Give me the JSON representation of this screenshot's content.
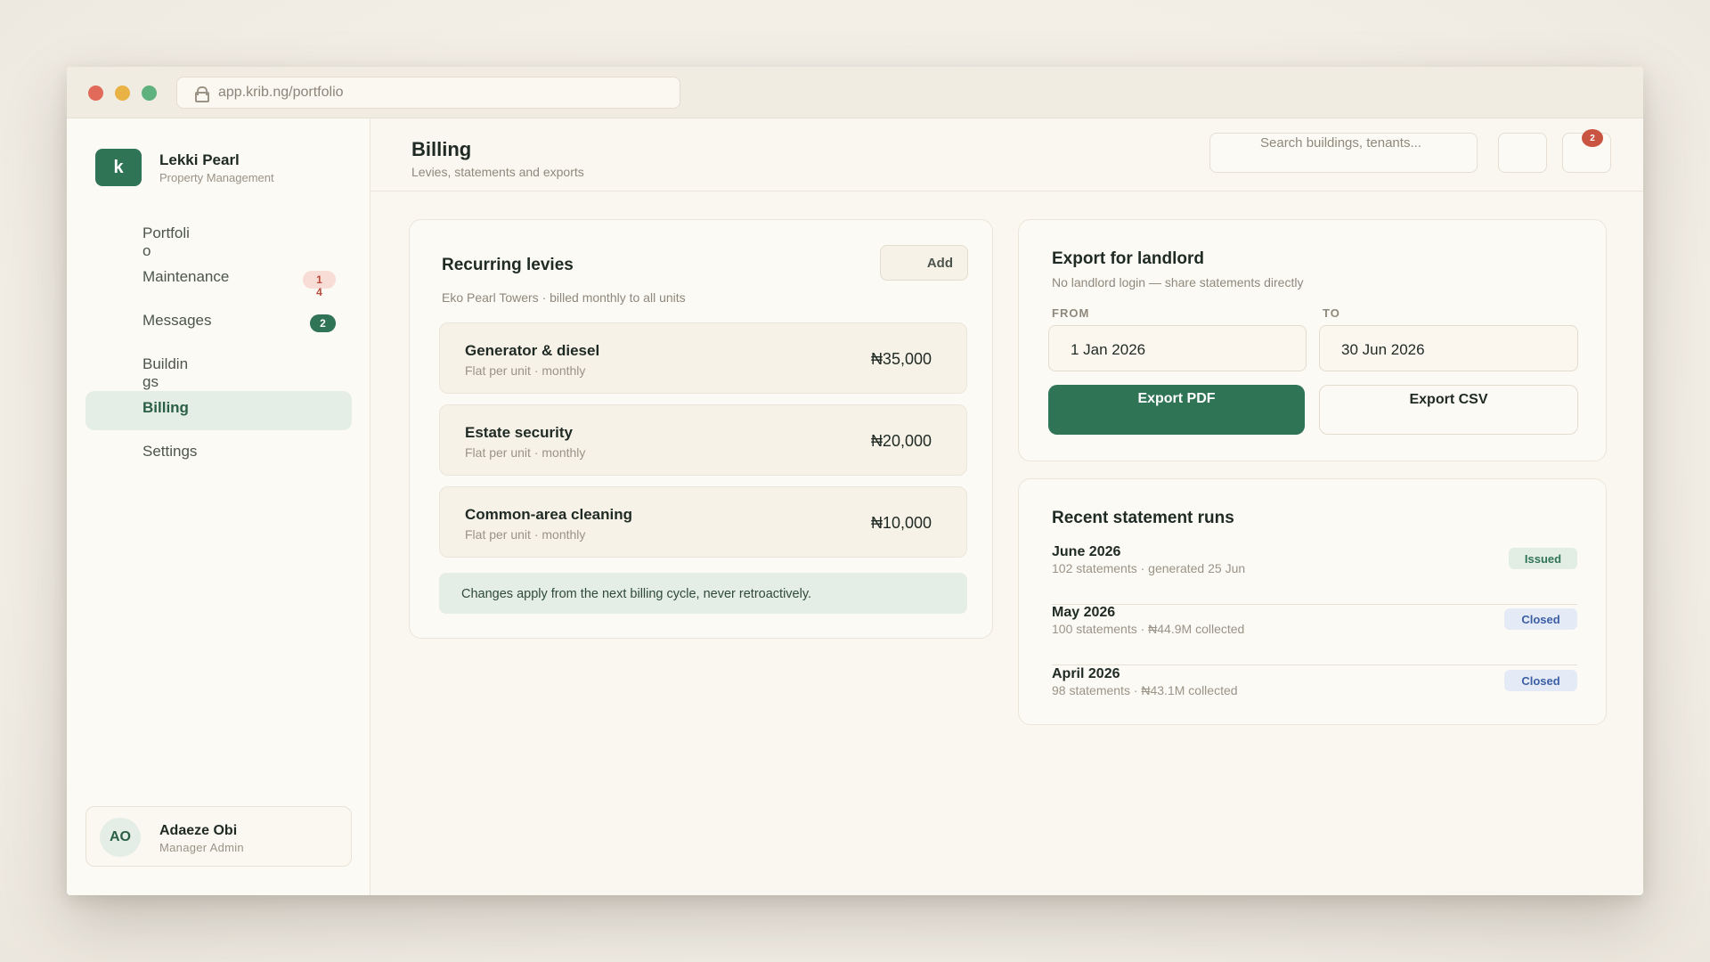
{
  "browser": {
    "url": "app.krib.ng/portfolio"
  },
  "brand": {
    "logo_letter": "k",
    "name": "Lekki Pearl",
    "subtitle": "Property Management"
  },
  "nav": {
    "items": [
      {
        "label": "Portfolio"
      },
      {
        "label": "Maintenance",
        "badge": "14"
      },
      {
        "label": "Messages",
        "badge": "2"
      },
      {
        "label": "Buildings"
      },
      {
        "label": "Billing"
      },
      {
        "label": "Settings"
      }
    ]
  },
  "user": {
    "initials": "AO",
    "name": "Adaeze Obi",
    "role": "Manager Admin"
  },
  "header": {
    "title": "Billing",
    "subtitle": "Levies, statements and exports",
    "search_placeholder": "Search buildings, tenants...",
    "notification_count": "2"
  },
  "levies": {
    "title": "Recurring levies",
    "subtitle": "Eko Pearl Towers · billed monthly to all units",
    "add_label": "Add",
    "items": [
      {
        "name": "Generator & diesel",
        "meta": "Flat per unit · monthly",
        "amount": "₦35,000"
      },
      {
        "name": "Estate security",
        "meta": "Flat per unit · monthly",
        "amount": "₦20,000"
      },
      {
        "name": "Common-area cleaning",
        "meta": "Flat per unit · monthly",
        "amount": "₦10,000"
      }
    ],
    "notice": "Changes apply from the next billing cycle, never retroactively."
  },
  "export": {
    "title": "Export for landlord",
    "subtitle": "No landlord login — share statements directly",
    "from_label": "FROM",
    "from_value": "1 Jan 2026",
    "to_label": "TO",
    "to_value": "30 Jun 2026",
    "pdf_label": "Export PDF",
    "csv_label": "Export CSV"
  },
  "runs": {
    "title": "Recent statement runs",
    "items": [
      {
        "title": "June 2026",
        "meta": "102 statements · generated 25 Jun",
        "status": "Issued"
      },
      {
        "title": "May 2026",
        "meta": "100 statements · ₦44.9M collected",
        "status": "Closed"
      },
      {
        "title": "April 2026",
        "meta": "98 statements · ₦43.1M collected",
        "status": "Closed"
      }
    ]
  },
  "colors": {
    "accent": "#2f7454",
    "background": "#faf7f0",
    "danger": "#c95441",
    "info": "#3b5ea5"
  }
}
